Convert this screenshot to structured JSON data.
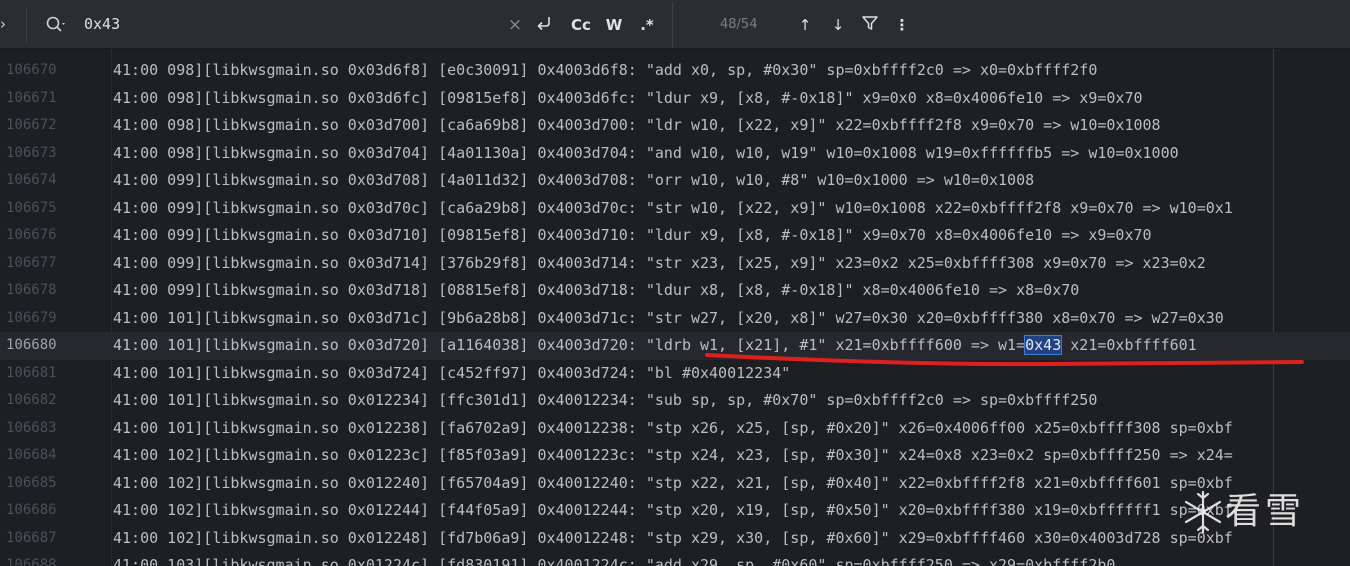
{
  "search": {
    "expand_glyph": "›",
    "query": "0x43",
    "clear_glyph": "×",
    "newline_glyph": "⮐",
    "match_case_label": "Cc",
    "words_label": "W",
    "regex_label": ".*",
    "match_count": "48/54",
    "prev_glyph": "↑",
    "next_glyph": "↓",
    "more_glyph": "⋮"
  },
  "colors": {
    "background": "#1e1f22",
    "toolbar": "#2b2d30",
    "current_line": "#26282e",
    "match_highlight": "#214283",
    "annotation_underline": "#e02020"
  },
  "editor": {
    "partial_top": "",
    "lines": [
      {
        "num": "106670",
        "text": "41:00 098][libkwsgmain.so 0x03d6f8] [e0c30091] 0x4003d6f8: \"add x0, sp, #0x30\" sp=0xbffff2c0 => x0=0xbffff2f0"
      },
      {
        "num": "106671",
        "text": "41:00 098][libkwsgmain.so 0x03d6fc] [09815ef8] 0x4003d6fc: \"ldur x9, [x8, #-0x18]\" x9=0x0 x8=0x4006fe10 => x9=0x70"
      },
      {
        "num": "106672",
        "text": "41:00 098][libkwsgmain.so 0x03d700] [ca6a69b8] 0x4003d700: \"ldr w10, [x22, x9]\" x22=0xbffff2f8 x9=0x70 => w10=0x1008"
      },
      {
        "num": "106673",
        "text": "41:00 098][libkwsgmain.so 0x03d704] [4a01130a] 0x4003d704: \"and w10, w10, w19\" w10=0x1008 w19=0xffffffb5 => w10=0x1000"
      },
      {
        "num": "106674",
        "text": "41:00 099][libkwsgmain.so 0x03d708] [4a011d32] 0x4003d708: \"orr w10, w10, #8\" w10=0x1000 => w10=0x1008"
      },
      {
        "num": "106675",
        "text": "41:00 099][libkwsgmain.so 0x03d70c] [ca6a29b8] 0x4003d70c: \"str w10, [x22, x9]\" w10=0x1008 x22=0xbffff2f8 x9=0x70 => w10=0x1"
      },
      {
        "num": "106676",
        "text": "41:00 099][libkwsgmain.so 0x03d710] [09815ef8] 0x4003d710: \"ldur x9, [x8, #-0x18]\" x9=0x70 x8=0x4006fe10 => x9=0x70"
      },
      {
        "num": "106677",
        "text": "41:00 099][libkwsgmain.so 0x03d714] [376b29f8] 0x4003d714: \"str x23, [x25, x9]\" x23=0x2 x25=0xbffff308 x9=0x70 => x23=0x2"
      },
      {
        "num": "106678",
        "text": "41:00 099][libkwsgmain.so 0x03d718] [08815ef8] 0x4003d718: \"ldur x8, [x8, #-0x18]\" x8=0x4006fe10 => x8=0x70"
      },
      {
        "num": "106679",
        "text": "41:00 101][libkwsgmain.so 0x03d71c] [9b6a28b8] 0x4003d71c: \"str w27, [x20, x8]\" w27=0x30 x20=0xbffff380 x8=0x70 => w27=0x30"
      },
      {
        "num": "106680",
        "text_before": "41:00 101][libkwsgmain.so 0x03d720] [a1164038] 0x4003d720: \"ldrb w1, [x21], #1\" x21=0xbffff600 => w1=",
        "match": "0x43",
        "text_after": " x21=0xbffff601"
      },
      {
        "num": "106681",
        "text": "41:00 101][libkwsgmain.so 0x03d724] [c452ff97] 0x4003d724: \"bl #0x40012234\""
      },
      {
        "num": "106682",
        "text": "41:00 101][libkwsgmain.so 0x012234] [ffc301d1] 0x40012234: \"sub sp, sp, #0x70\" sp=0xbffff2c0 => sp=0xbffff250"
      },
      {
        "num": "106683",
        "text": "41:00 101][libkwsgmain.so 0x012238] [fa6702a9] 0x40012238: \"stp x26, x25, [sp, #0x20]\" x26=0x4006ff00 x25=0xbffff308 sp=0xbf"
      },
      {
        "num": "106684",
        "text": "41:00 102][libkwsgmain.so 0x01223c] [f85f03a9] 0x4001223c: \"stp x24, x23, [sp, #0x30]\" x24=0x8 x23=0x2 sp=0xbffff250 => x24="
      },
      {
        "num": "106685",
        "text": "41:00 102][libkwsgmain.so 0x012240] [f65704a9] 0x40012240: \"stp x22, x21, [sp, #0x40]\" x22=0xbffff2f8 x21=0xbffff601 sp=0xbf"
      },
      {
        "num": "106686",
        "text": "41:00 102][libkwsgmain.so 0x012244] [f44f05a9] 0x40012244: \"stp x20, x19, [sp, #0x50]\" x20=0xbffff380 x19=0xbffffff1 sp=0xbf"
      },
      {
        "num": "106687",
        "text": "41:00 102][libkwsgmain.so 0x012248] [fd7b06a9] 0x40012248: \"stp x29, x30, [sp, #0x60]\" x29=0xbffff460 x30=0x4003d728 sp=0xbf"
      },
      {
        "num": "106688",
        "text": "41:00 103][libkwsgmain.so 0x01224c] [fd830191] 0x4001224c: \"add x29, sp, #0x60\" sp=0xbffff250 => x29=0xbffff2b0"
      }
    ]
  },
  "watermark": {
    "text": "看雪",
    "icon": "snowflake-icon"
  }
}
